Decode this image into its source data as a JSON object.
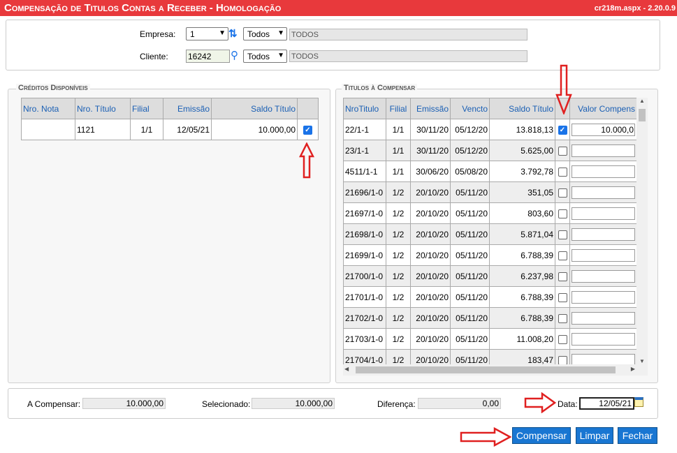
{
  "title": "Compensação de Titulos Contas a Receber  - Homologação",
  "version": "cr218m.aspx - 2.20.0.9",
  "filters": {
    "empresa_label": "Empresa:",
    "empresa_value": "1",
    "empresa_scope": "Todos",
    "empresa_desc": "TODOS",
    "cliente_label": "Cliente:",
    "cliente_value": "16242",
    "cliente_scope": "Todos",
    "cliente_desc": "TODOS"
  },
  "creditos": {
    "legend": "Créditos Disponíveis",
    "headers": [
      "Nro. Nota",
      "Nro. Título",
      "Filial",
      "Emissão",
      "Saldo Título"
    ],
    "rows": [
      {
        "nota": "",
        "titulo": "1121",
        "filial": "1/1",
        "emissao": "12/05/21",
        "saldo": "10.000,00",
        "checked": true
      }
    ]
  },
  "titulos": {
    "legend": "Titulos à Compensar",
    "headers": [
      "NroTitulo",
      "Filial",
      "Emissão",
      "Vencto",
      "Saldo Título",
      "",
      "Valor Compens"
    ],
    "rows": [
      {
        "nro": "22/1-1",
        "filial": "1/1",
        "emissao": "30/11/20",
        "vencto": "05/12/20",
        "saldo": "13.818,13",
        "checked": true,
        "valor": "10.000,0"
      },
      {
        "nro": "23/1-1",
        "filial": "1/1",
        "emissao": "30/11/20",
        "vencto": "05/12/20",
        "saldo": "5.625,00",
        "checked": false,
        "valor": ""
      },
      {
        "nro": "4511/1-1",
        "filial": "1/1",
        "emissao": "30/06/20",
        "vencto": "05/08/20",
        "saldo": "3.792,78",
        "checked": false,
        "valor": ""
      },
      {
        "nro": "21696/1-0",
        "filial": "1/2",
        "emissao": "20/10/20",
        "vencto": "05/11/20",
        "saldo": "351,05",
        "checked": false,
        "valor": ""
      },
      {
        "nro": "21697/1-0",
        "filial": "1/2",
        "emissao": "20/10/20",
        "vencto": "05/11/20",
        "saldo": "803,60",
        "checked": false,
        "valor": ""
      },
      {
        "nro": "21698/1-0",
        "filial": "1/2",
        "emissao": "20/10/20",
        "vencto": "05/11/20",
        "saldo": "5.871,04",
        "checked": false,
        "valor": ""
      },
      {
        "nro": "21699/1-0",
        "filial": "1/2",
        "emissao": "20/10/20",
        "vencto": "05/11/20",
        "saldo": "6.788,39",
        "checked": false,
        "valor": ""
      },
      {
        "nro": "21700/1-0",
        "filial": "1/2",
        "emissao": "20/10/20",
        "vencto": "05/11/20",
        "saldo": "6.237,98",
        "checked": false,
        "valor": ""
      },
      {
        "nro": "21701/1-0",
        "filial": "1/2",
        "emissao": "20/10/20",
        "vencto": "05/11/20",
        "saldo": "6.788,39",
        "checked": false,
        "valor": ""
      },
      {
        "nro": "21702/1-0",
        "filial": "1/2",
        "emissao": "20/10/20",
        "vencto": "05/11/20",
        "saldo": "6.788,39",
        "checked": false,
        "valor": ""
      },
      {
        "nro": "21703/1-0",
        "filial": "1/2",
        "emissao": "20/10/20",
        "vencto": "05/11/20",
        "saldo": "11.008,20",
        "checked": false,
        "valor": ""
      },
      {
        "nro": "21704/1-0",
        "filial": "1/2",
        "emissao": "20/10/20",
        "vencto": "05/11/20",
        "saldo": "183,47",
        "checked": false,
        "valor": ""
      }
    ]
  },
  "totals": {
    "a_compensar_label": "A Compensar:",
    "a_compensar_value": "10.000,00",
    "selecionado_label": "Selecionado:",
    "selecionado_value": "10.000,00",
    "diferenca_label": "Diferença:",
    "diferenca_value": "0,00",
    "data_label": "Data:",
    "data_value": "12/05/21"
  },
  "buttons": {
    "compensar": "Compensar",
    "limpar": "Limpar",
    "fechar": "Fechar"
  },
  "colors": {
    "title_bar": "#e8393c",
    "button": "#1976d2",
    "annotation_arrow": "#e02020"
  }
}
